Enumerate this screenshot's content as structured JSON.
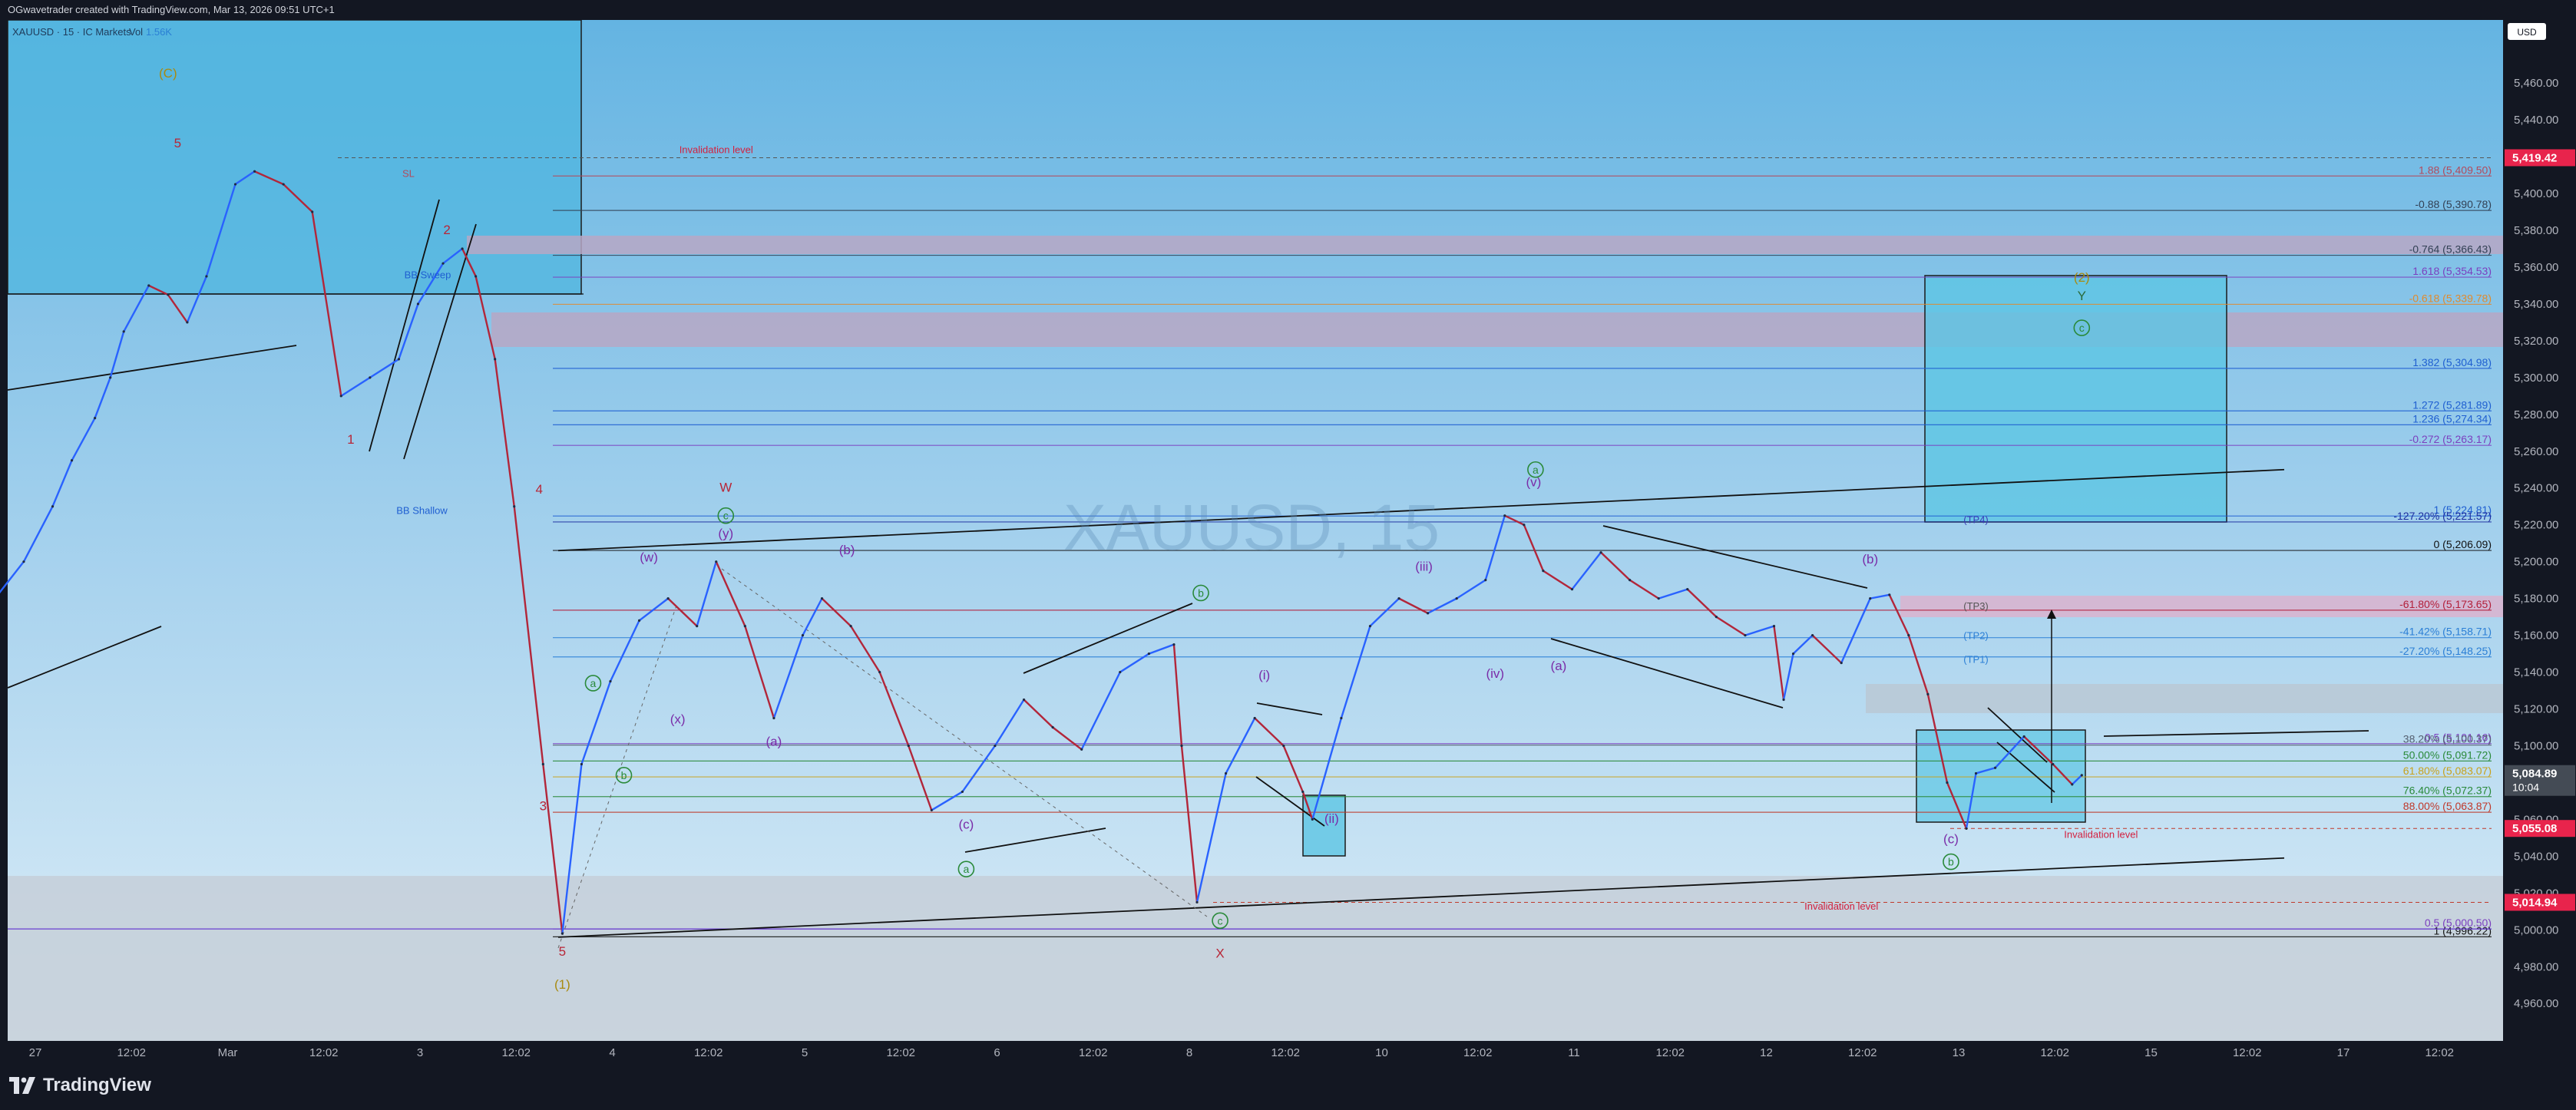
{
  "header": {
    "text": "OGwavetrader created with TradingView.com, Mar 13, 2026 09:51 UTC+1"
  },
  "legend": {
    "symbol": "XAUUSD · 15 · IC Markets",
    "vol_label": "Vol",
    "vol_value": "1.56K"
  },
  "currency_button": "USD",
  "watermark": "XAUUSD, 15",
  "brand": "TradingView",
  "colors": {
    "up": "#2962ff",
    "down": "#b2263a",
    "bg_top": "#6ab8e3",
    "bg_bottom": "#d4e9f5",
    "accent": "#f23645",
    "alert": "#e8244c"
  },
  "chart_data": {
    "type": "line",
    "title": "XAUUSD, 15",
    "ylim": [
      4948,
      5488
    ],
    "y_ticks": [
      4960,
      4980,
      5000,
      5020,
      5040,
      5060,
      5080,
      5100,
      5120,
      5140,
      5160,
      5180,
      5200,
      5220,
      5240,
      5260,
      5280,
      5300,
      5320,
      5340,
      5360,
      5380,
      5400,
      5420,
      5440,
      5460
    ],
    "y_tick_labels": [
      "4,960.00",
      "4,980.00",
      "5,000.00",
      "5,020.00",
      "5,040.00",
      "5,060.00",
      "5,080.00",
      "5,100.00",
      "5,120.00",
      "5,140.00",
      "5,160.00",
      "5,180.00",
      "5,200.00",
      "5,220.00",
      "5,240.00",
      "5,260.00",
      "5,280.00",
      "5,300.00",
      "5,320.00",
      "5,340.00",
      "5,360.00",
      "5,380.00",
      "5,400.00",
      "5,420.00",
      "5,440.00",
      "5,460.00"
    ],
    "x_ticks": [
      {
        "label": "27",
        "t": 0.0
      },
      {
        "label": "12:02",
        "t": 0.5
      },
      {
        "label": "Mar",
        "t": 1.0
      },
      {
        "label": "12:02",
        "t": 1.5
      },
      {
        "label": "3",
        "t": 2.0
      },
      {
        "label": "12:02",
        "t": 2.5
      },
      {
        "label": "4",
        "t": 3.0
      },
      {
        "label": "12:02",
        "t": 3.5
      },
      {
        "label": "5",
        "t": 4.0
      },
      {
        "label": "12:02",
        "t": 4.5
      },
      {
        "label": "6",
        "t": 5.0
      },
      {
        "label": "12:02",
        "t": 5.5
      },
      {
        "label": "8",
        "t": 6.0
      },
      {
        "label": "12:02",
        "t": 6.5
      },
      {
        "label": "10",
        "t": 7.0
      },
      {
        "label": "12:02",
        "t": 7.5
      },
      {
        "label": "11",
        "t": 8.0
      },
      {
        "label": "12:02",
        "t": 8.5
      },
      {
        "label": "12",
        "t": 9.0
      },
      {
        "label": "12:02",
        "t": 9.5
      },
      {
        "label": "13",
        "t": 10.0
      },
      {
        "label": "12:02",
        "t": 10.5
      },
      {
        "label": "15",
        "t": 11.0
      },
      {
        "label": "12:02",
        "t": 11.5
      },
      {
        "label": "17",
        "t": 12.0
      },
      {
        "label": "12:02",
        "t": 12.5
      }
    ],
    "series": [
      {
        "values": [
          [
            -0.85,
            5190
          ],
          [
            -0.7,
            5200
          ],
          [
            -0.55,
            5185
          ],
          [
            -0.4,
            5178
          ],
          [
            -0.25,
            5180
          ],
          [
            -0.1,
            5200
          ],
          [
            0.05,
            5230
          ],
          [
            0.15,
            5255
          ],
          [
            0.27,
            5278
          ],
          [
            0.35,
            5300
          ],
          [
            0.42,
            5325
          ],
          [
            0.55,
            5350
          ],
          [
            0.65,
            5345
          ],
          [
            0.75,
            5330
          ],
          [
            0.85,
            5355
          ],
          [
            1.0,
            5405
          ],
          [
            1.1,
            5412
          ],
          [
            1.25,
            5405
          ],
          [
            1.4,
            5390
          ],
          [
            1.55,
            5290
          ],
          [
            1.7,
            5300
          ],
          [
            1.85,
            5310
          ],
          [
            1.95,
            5340
          ],
          [
            2.08,
            5362
          ],
          [
            2.18,
            5370
          ],
          [
            2.25,
            5355
          ],
          [
            2.35,
            5310
          ],
          [
            2.45,
            5230
          ],
          [
            2.6,
            5090
          ],
          [
            2.7,
            4998
          ],
          [
            2.8,
            5090
          ],
          [
            2.95,
            5135
          ],
          [
            3.1,
            5168
          ],
          [
            3.25,
            5180
          ],
          [
            3.4,
            5165
          ],
          [
            3.5,
            5200
          ],
          [
            3.65,
            5165
          ],
          [
            3.8,
            5115
          ],
          [
            3.95,
            5160
          ],
          [
            4.05,
            5180
          ],
          [
            4.2,
            5165
          ],
          [
            4.35,
            5140
          ],
          [
            4.5,
            5100
          ],
          [
            4.62,
            5065
          ],
          [
            4.78,
            5075
          ],
          [
            4.95,
            5100
          ],
          [
            5.1,
            5125
          ],
          [
            5.25,
            5110
          ],
          [
            5.4,
            5098
          ],
          [
            5.6,
            5140
          ],
          [
            5.75,
            5150
          ],
          [
            5.88,
            5155
          ],
          [
            5.92,
            5100
          ],
          [
            6.0,
            5015
          ],
          [
            6.15,
            5085
          ],
          [
            6.3,
            5115
          ],
          [
            6.45,
            5100
          ],
          [
            6.55,
            5075
          ],
          [
            6.6,
            5060
          ],
          [
            6.75,
            5115
          ],
          [
            6.9,
            5165
          ],
          [
            7.05,
            5180
          ],
          [
            7.2,
            5172
          ],
          [
            7.35,
            5180
          ],
          [
            7.5,
            5190
          ],
          [
            7.6,
            5225
          ],
          [
            7.7,
            5220
          ],
          [
            7.8,
            5195
          ],
          [
            7.95,
            5185
          ],
          [
            8.1,
            5205
          ],
          [
            8.25,
            5190
          ],
          [
            8.4,
            5180
          ],
          [
            8.55,
            5185
          ],
          [
            8.7,
            5170
          ],
          [
            8.85,
            5160
          ],
          [
            9.0,
            5165
          ],
          [
            9.05,
            5125
          ],
          [
            9.1,
            5150
          ],
          [
            9.2,
            5160
          ],
          [
            9.35,
            5145
          ],
          [
            9.5,
            5180
          ],
          [
            9.6,
            5182
          ],
          [
            9.7,
            5160
          ],
          [
            9.8,
            5128
          ],
          [
            9.9,
            5080
          ],
          [
            10.0,
            5055
          ],
          [
            10.05,
            5085
          ],
          [
            10.15,
            5088
          ],
          [
            10.3,
            5105
          ],
          [
            10.45,
            5090
          ],
          [
            10.55,
            5079
          ],
          [
            10.6,
            5084
          ]
        ]
      }
    ],
    "horizontal_levels": [
      {
        "label": "1.88 (5,409.50)",
        "y": 5409.5,
        "color": "#b34a5c"
      },
      {
        "label": "-0.88 (5,390.78)",
        "y": 5390.78,
        "color": "#334155"
      },
      {
        "label": "-0.764 (5,366.43)",
        "y": 5366.43,
        "color": "#334155"
      },
      {
        "label": "1.618 (5,354.53)",
        "y": 5354.53,
        "color": "#7b3fbf"
      },
      {
        "label": "-0.618 (5,339.78)",
        "y": 5339.78,
        "color": "#e08a2e"
      },
      {
        "label": "1.382 (5,304.98)",
        "y": 5304.98,
        "color": "#1f5fd1"
      },
      {
        "label": "1.272 (5,281.89)",
        "y": 5281.89,
        "color": "#1f5fd1"
      },
      {
        "label": "1.236 (5,274.34)",
        "y": 5274.34,
        "color": "#1f5fd1"
      },
      {
        "label": "-0.272 (5,263.17)",
        "y": 5263.17,
        "color": "#7b3fbf"
      },
      {
        "label": "1 (5,224.81)",
        "y": 5224.81,
        "color": "#1f5fd1"
      },
      {
        "label": "-127.20% (5,221.57)",
        "y": 5221.57,
        "color": "#1e2fa0"
      },
      {
        "label": "0 (5,206.09)",
        "y": 5206.09,
        "color": "#111111"
      },
      {
        "label": "-61.80% (5,173.65)",
        "y": 5173.65,
        "color": "#b21f3a"
      },
      {
        "label": "-41.42% (5,158.71)",
        "y": 5158.71,
        "color": "#2b7fd6"
      },
      {
        "label": "-27.20% (5,148.25)",
        "y": 5148.25,
        "color": "#2b7fd6"
      },
      {
        "label": "0.5 (5,101.16)",
        "y": 5101.16,
        "color": "#7b3fbf"
      },
      {
        "label": "38.20% (5,100.37)",
        "y": 5100.37,
        "color": "#556070"
      },
      {
        "label": "50.00% (5,091.72)",
        "y": 5091.72,
        "color": "#2a8a3a"
      },
      {
        "label": "61.80% (5,083.07)",
        "y": 5083.07,
        "color": "#c8a21c"
      },
      {
        "label": "76.40% (5,072.37)",
        "y": 5072.37,
        "color": "#2a8a3a"
      },
      {
        "label": "88.00% (5,063.87)",
        "y": 5063.87,
        "color": "#c0392b"
      },
      {
        "label": "0.5 (5,000.50)",
        "y": 5000.5,
        "color": "#7b3fbf"
      },
      {
        "label": "1 (4,996.22)",
        "y": 4996.22,
        "color": "#111111"
      }
    ],
    "axis_price_tags": [
      {
        "label": "5,419.42",
        "y": 5419.42,
        "color": "#e8244c"
      },
      {
        "label": "5,084.89",
        "y": 5084.89,
        "color": "#444b55",
        "sub": "10:04"
      },
      {
        "label": "5,055.08",
        "y": 5055.08,
        "color": "#e8244c"
      },
      {
        "label": "5,014.94",
        "y": 5014.94,
        "color": "#e8244c"
      }
    ],
    "annotations": [
      {
        "text": "Invalidation level",
        "t": 3.5,
        "y": 5422,
        "color": "#d3203f"
      },
      {
        "text": "Invalidation level",
        "t": 9.35,
        "y": 5011,
        "color": "#d3203f"
      },
      {
        "text": "Invalidation level",
        "t": 10.7,
        "y": 5050,
        "color": "#d3203f"
      },
      {
        "text": "SL",
        "t": 1.9,
        "y": 5409,
        "color": "#b34a5c"
      },
      {
        "text": "BB Sweep",
        "t": 2.0,
        "y": 5354,
        "color": "#1f5fd1"
      },
      {
        "text": "BB Shallow",
        "t": 1.97,
        "y": 5226,
        "color": "#1f5fd1"
      },
      {
        "text": "(TP4)",
        "t": 10.05,
        "y": 5221,
        "color": "#3b3bb8"
      },
      {
        "text": "(TP3)",
        "t": 10.05,
        "y": 5174,
        "color": "#555"
      },
      {
        "text": "(TP2)",
        "t": 10.05,
        "y": 5158,
        "color": "#2b7fd6"
      },
      {
        "text": "(TP1)",
        "t": 10.05,
        "y": 5145,
        "color": "#2b7fd6"
      }
    ],
    "wave_labels": [
      {
        "text": "(C)",
        "t": 0.65,
        "y": 5463,
        "color": "#a88a10"
      },
      {
        "text": "5",
        "t": 0.7,
        "y": 5425,
        "color": "#b82536"
      },
      {
        "text": "2",
        "t": 2.1,
        "y": 5378,
        "color": "#b82536"
      },
      {
        "text": "1",
        "t": 1.6,
        "y": 5264,
        "color": "#b82536"
      },
      {
        "text": "4",
        "t": 2.58,
        "y": 5237,
        "color": "#b82536"
      },
      {
        "text": "3",
        "t": 2.6,
        "y": 5065,
        "color": "#b82536"
      },
      {
        "text": "5",
        "t": 2.7,
        "y": 4986,
        "color": "#b82536"
      },
      {
        "text": "(1)",
        "t": 2.7,
        "y": 4968,
        "color": "#a88a10"
      },
      {
        "text": "W",
        "t": 3.55,
        "y": 5238,
        "color": "#b82536"
      },
      {
        "text": "(y)",
        "t": 3.55,
        "y": 5213,
        "color": "#7a2ca8"
      },
      {
        "text": "(w)",
        "t": 3.15,
        "y": 5200,
        "color": "#7a2ca8"
      },
      {
        "text": "(x)",
        "t": 3.3,
        "y": 5112,
        "color": "#7a2ca8"
      },
      {
        "text": "(a)",
        "t": 3.8,
        "y": 5100,
        "color": "#7a2ca8"
      },
      {
        "text": "(b)",
        "t": 4.18,
        "y": 5204,
        "color": "#7a2ca8"
      },
      {
        "text": "(c)",
        "t": 4.8,
        "y": 5055,
        "color": "#7a2ca8"
      },
      {
        "text": "X",
        "t": 6.12,
        "y": 4985,
        "color": "#b82536"
      },
      {
        "text": "(i)",
        "t": 6.35,
        "y": 5136,
        "color": "#7a2ca8"
      },
      {
        "text": "(ii)",
        "t": 6.7,
        "y": 5058,
        "color": "#7a2ca8"
      },
      {
        "text": "(iii)",
        "t": 7.18,
        "y": 5195,
        "color": "#7a2ca8"
      },
      {
        "text": "(iv)",
        "t": 7.55,
        "y": 5137,
        "color": "#7a2ca8"
      },
      {
        "text": "(v)",
        "t": 7.75,
        "y": 5241,
        "color": "#7a2ca8"
      },
      {
        "text": "(a)",
        "t": 7.88,
        "y": 5141,
        "color": "#7a2ca8"
      },
      {
        "text": "(b)",
        "t": 9.5,
        "y": 5199,
        "color": "#7a2ca8"
      },
      {
        "text": "(c)",
        "t": 9.92,
        "y": 5047,
        "color": "#7a2ca8"
      },
      {
        "text": "Y",
        "t": 10.6,
        "y": 5342,
        "color": "#2a6a3a"
      },
      {
        "text": "(2)",
        "t": 10.6,
        "y": 5352,
        "color": "#a88a10"
      }
    ],
    "circled_labels": [
      {
        "text": "c",
        "t": 3.55,
        "y": 5225,
        "color": "#2a8a3a"
      },
      {
        "text": "a",
        "t": 2.86,
        "y": 5134,
        "color": "#2a8a3a"
      },
      {
        "text": "b",
        "t": 3.02,
        "y": 5084,
        "color": "#2a8a3a"
      },
      {
        "text": "b",
        "t": 6.02,
        "y": 5183,
        "color": "#2a8a3a"
      },
      {
        "text": "a",
        "t": 4.8,
        "y": 5033,
        "color": "#2a8a3a"
      },
      {
        "text": "c",
        "t": 6.12,
        "y": 5005,
        "color": "#2a8a3a"
      },
      {
        "text": "a",
        "t": 7.76,
        "y": 5250,
        "color": "#2a8a3a"
      },
      {
        "text": "b",
        "t": 9.92,
        "y": 5037,
        "color": "#2a8a3a"
      },
      {
        "text": "c",
        "t": 10.6,
        "y": 5327,
        "color": "#2a8a3a"
      }
    ]
  }
}
